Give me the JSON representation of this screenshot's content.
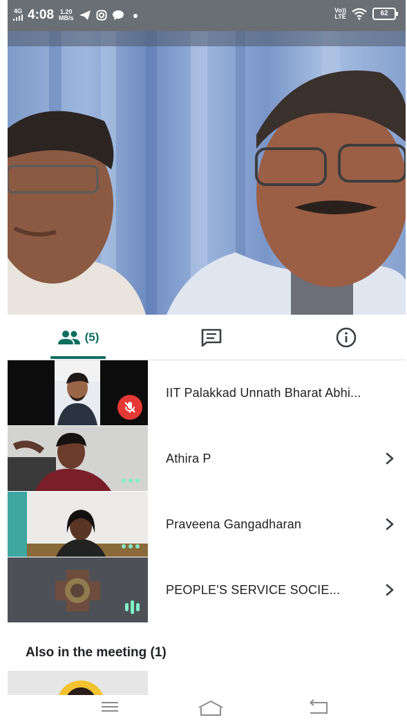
{
  "status_bar": {
    "network": "4G",
    "time": "4:08",
    "speed_value": "1.20",
    "speed_unit": "MB/s",
    "lte_top": "Vo))",
    "lte_bottom": "LTE",
    "battery": "62"
  },
  "tabs": {
    "people_count": "(5)"
  },
  "participants": [
    {
      "name": "IIT Palakkad Unnath Bharat Abhi...",
      "status": "muted"
    },
    {
      "name": "Athira P",
      "status": "idle"
    },
    {
      "name": "Praveena Gangadharan",
      "status": "idle"
    },
    {
      "name": "PEOPLE'S SERVICE SOCIE...",
      "status": "speaking"
    }
  ],
  "also_in_meeting": {
    "label": "Also in the meeting (1)"
  },
  "colors": {
    "accent": "#0b6e5e",
    "mute_red": "#e53935",
    "indicator_green": "#7ef0c5"
  },
  "icons": [
    "people-icon",
    "chat-icon",
    "info-icon",
    "chevron-right-icon",
    "mic-off-icon",
    "menu-icon",
    "home-icon",
    "back-icon"
  ]
}
